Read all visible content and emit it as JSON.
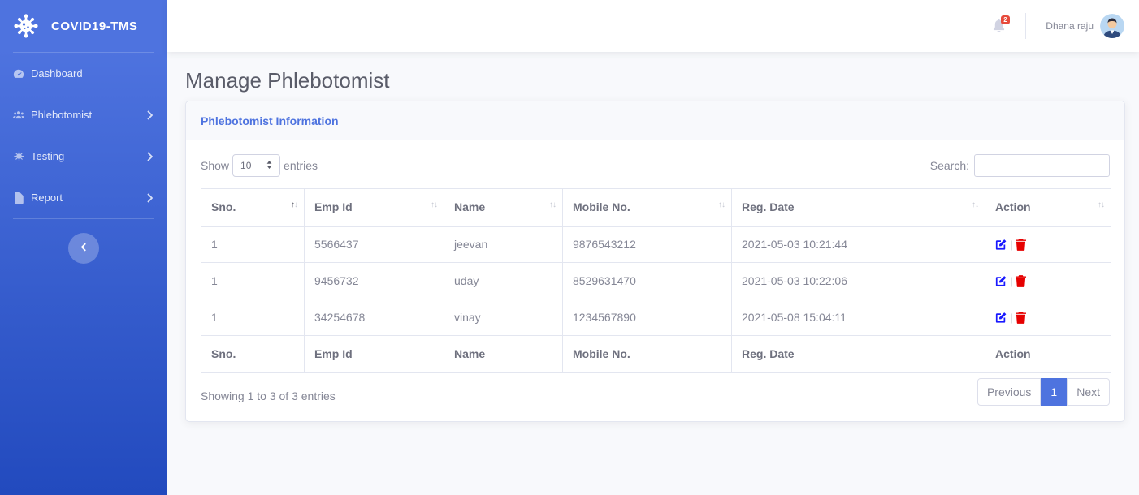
{
  "brand": {
    "name": "COVID19-TMS",
    "icon": "virus-icon"
  },
  "sidebar": {
    "items": [
      {
        "label": "Dashboard",
        "icon": "dashboard-icon",
        "has_submenu": false
      },
      {
        "label": "Phlebotomist",
        "icon": "users-icon",
        "has_submenu": true
      },
      {
        "label": "Testing",
        "icon": "virus-icon",
        "has_submenu": true
      },
      {
        "label": "Report",
        "icon": "file-icon",
        "has_submenu": true
      }
    ],
    "toggle_icon": "chevron-left-icon"
  },
  "topbar": {
    "notification_count": "2",
    "user_name": "Dhana raju"
  },
  "page": {
    "title": "Manage Phlebotomist"
  },
  "card": {
    "title": "Phlebotomist Information"
  },
  "table_controls": {
    "show_label": "Show",
    "entries_value": "10",
    "entries_label": "entries",
    "search_label": "Search:",
    "search_value": ""
  },
  "table": {
    "columns": [
      "Sno.",
      "Emp Id",
      "Name",
      "Mobile No.",
      "Reg. Date",
      "Action"
    ],
    "rows": [
      [
        "1",
        "5566437",
        "jeevan",
        "9876543212",
        "2021-05-03 10:21:44"
      ],
      [
        "1",
        "9456732",
        "uday",
        "8529631470",
        "2021-05-03 10:22:06"
      ],
      [
        "1",
        "34254678",
        "vinay",
        "1234567890",
        "2021-05-08 15:04:11"
      ]
    ],
    "action_separator": "|"
  },
  "footer": {
    "info": "Showing 1 to 3 of 3 entries",
    "pagination": {
      "previous": "Previous",
      "current": "1",
      "next": "Next"
    }
  },
  "colors": {
    "primary": "#4e73df",
    "danger": "#e60000",
    "edit": "#1a1aff"
  }
}
